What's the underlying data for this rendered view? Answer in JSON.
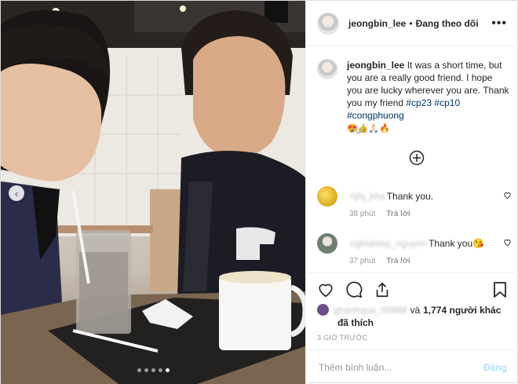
{
  "header": {
    "username": "jeongbin_lee",
    "separator": "•",
    "follow_status": "Đang theo dõi",
    "more_icon": "more-options-icon"
  },
  "caption": {
    "username": "jeongbin_lee",
    "text": "It was a short time, but you are a really good friend. I hope you are lucky wherever you are. Thank you my friend",
    "hashtags": [
      "#cp23",
      "#cp10",
      "#congphuong"
    ],
    "emojis": "😍👍🙏🏻🔥",
    "time": "3 giờ"
  },
  "comments": [
    {
      "username": "hjhj_kha",
      "text": "Thank you.",
      "time": "38 phút",
      "reply": "Trả lời",
      "avatar_color": "#e0b400"
    },
    {
      "username": "nghiahiep_nguyen",
      "text": "Thank you😘",
      "time": "37 phút",
      "reply": "Trả lời",
      "avatar_color": "#7a8a7a"
    }
  ],
  "likes": {
    "names": "ghanhqua_09988",
    "connector": "và",
    "count_text": "1,774 người khác",
    "suffix": "đã thích"
  },
  "posted_ago": "3 GIỜ TRƯỚC",
  "comment_input": {
    "placeholder": "Thêm bình luận...",
    "post_label": "Đăng"
  },
  "carousel": {
    "dots": 5,
    "active_index": 4
  },
  "colors": {
    "hashtag": "#003569",
    "muted": "#999999",
    "post_disabled": "#b2dffc"
  }
}
